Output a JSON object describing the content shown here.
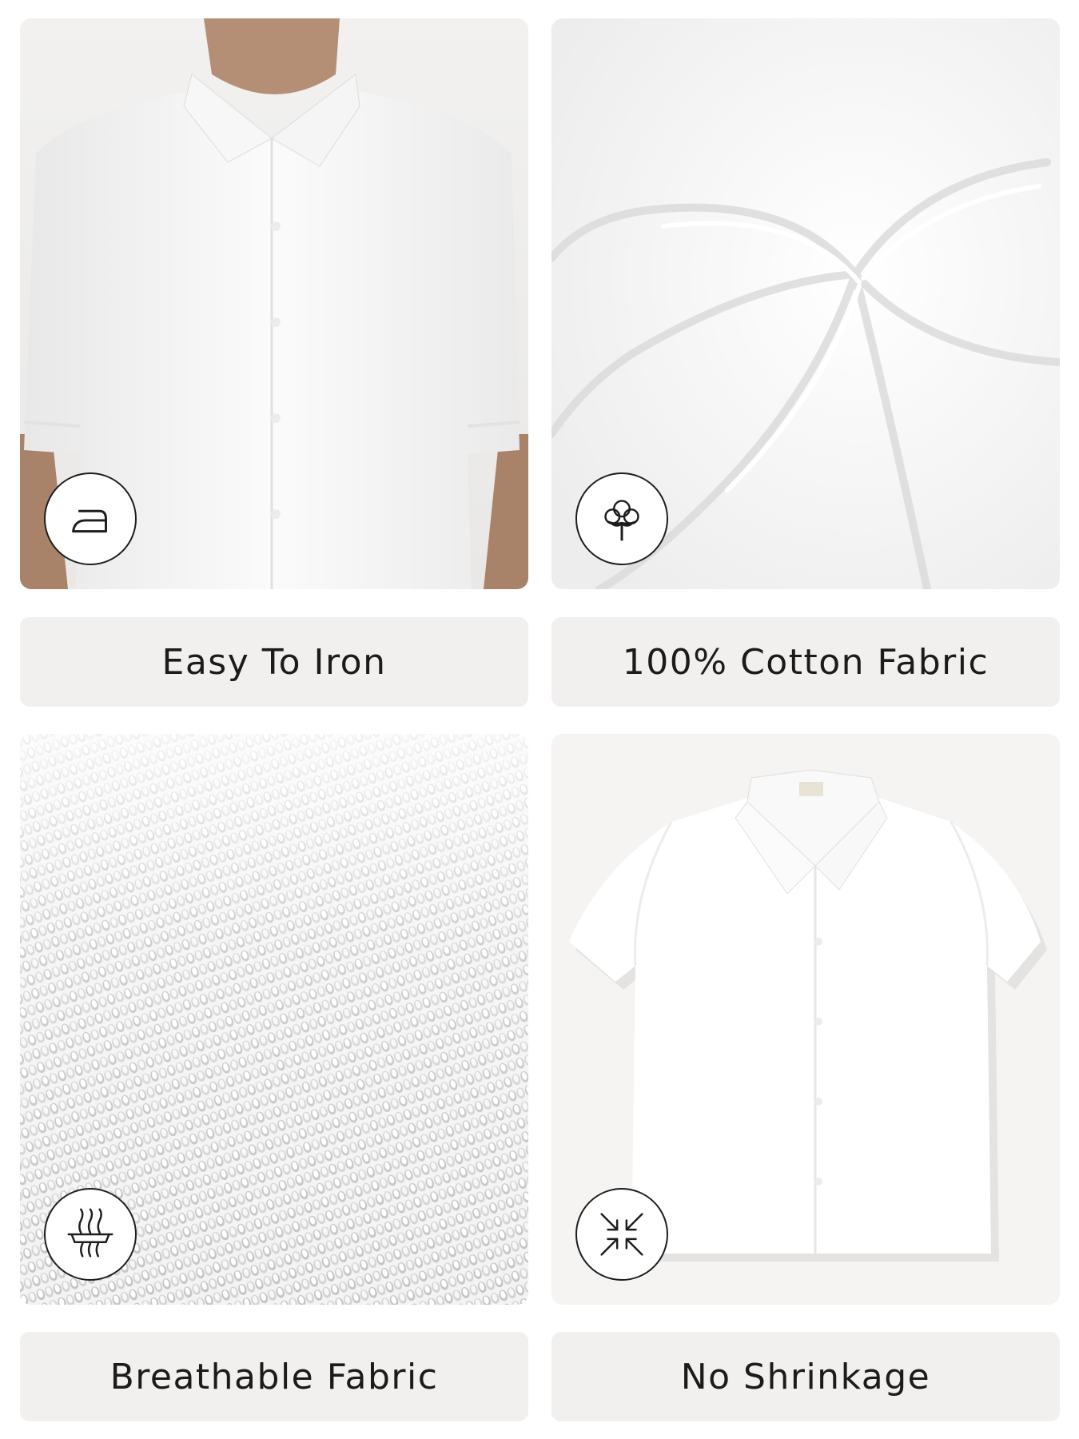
{
  "features": [
    {
      "label": "Easy To Iron",
      "icon": "iron-icon"
    },
    {
      "label": "100% Cotton Fabric",
      "icon": "cotton-flower-icon"
    },
    {
      "label": "Breathable Fabric",
      "icon": "breathable-fabric-icon"
    },
    {
      "label": "No Shrinkage",
      "icon": "no-shrink-arrows-icon"
    }
  ],
  "colors": {
    "background": "#ffffff",
    "label_box": "#f1f0ee",
    "text": "#1b1b1b",
    "icon_stroke": "#1d1d1d"
  }
}
